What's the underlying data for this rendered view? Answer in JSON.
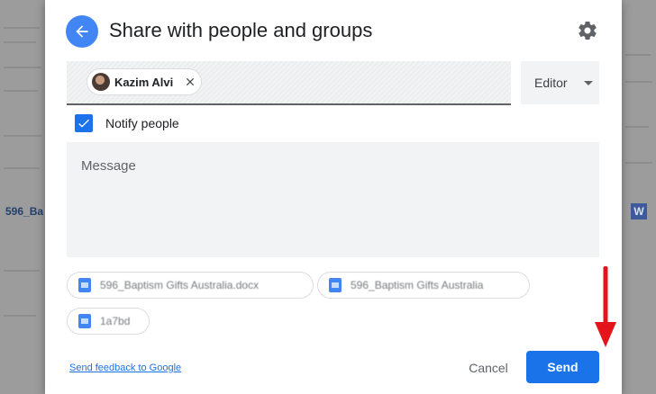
{
  "background": {
    "left_label": "596_Ba",
    "right_label": "W"
  },
  "dialog": {
    "title": "Share with people and groups",
    "back_icon": "arrow-back-icon",
    "settings_icon": "gear-icon",
    "recipients": [
      {
        "name": "Kazim Alvi"
      }
    ],
    "role": {
      "selected": "Editor"
    },
    "notify": {
      "label": "Notify people",
      "checked": true
    },
    "message": {
      "placeholder": "Message"
    },
    "attachments": [
      {
        "name": "596_Baptism Gifts Australia.docx",
        "color": "#4285f4"
      },
      {
        "name": "596_Baptism Gifts Australia",
        "color": "#4285f4"
      },
      {
        "name": "1a7bd",
        "color": "#4285f4"
      }
    ],
    "footer": {
      "feedback_link": "Send feedback to Google",
      "cancel_label": "Cancel",
      "send_label": "Send"
    }
  },
  "colors": {
    "accent": "#1a73e8",
    "annotation_arrow": "#e3141b"
  }
}
